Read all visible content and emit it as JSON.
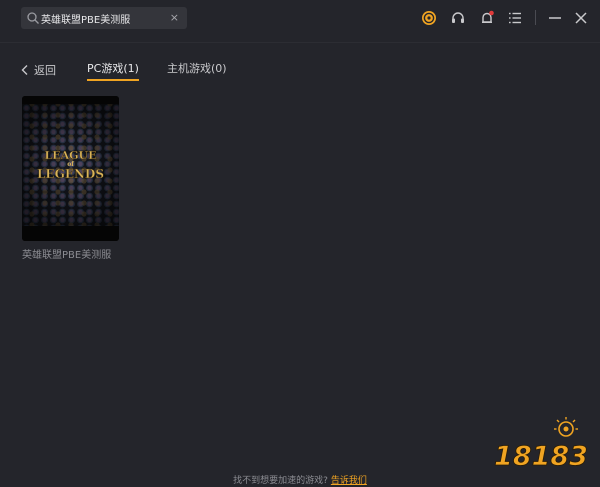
{
  "search": {
    "value": "英雄联盟PBE美测服",
    "clear": "×"
  },
  "icons": [
    "coin-icon",
    "headset-icon",
    "bell-icon",
    "menu-icon",
    "minimize-icon",
    "close-icon"
  ],
  "colors": {
    "accent": "#f0a422",
    "background": "#24252b",
    "notify": "#e23b3b"
  },
  "nav": {
    "back": "返回",
    "tabs": [
      {
        "label": "PC游戏(1)",
        "active": true
      },
      {
        "label": "主机游戏(0)",
        "active": false
      }
    ]
  },
  "results": [
    {
      "title": "英雄联盟PBE美测服",
      "logo_text": [
        "LEAGUE",
        "of",
        "LEGENDS"
      ]
    }
  ],
  "footer": {
    "text": "找不到想要加速的游戏?",
    "link": "告诉我们"
  },
  "watermark": "18183"
}
